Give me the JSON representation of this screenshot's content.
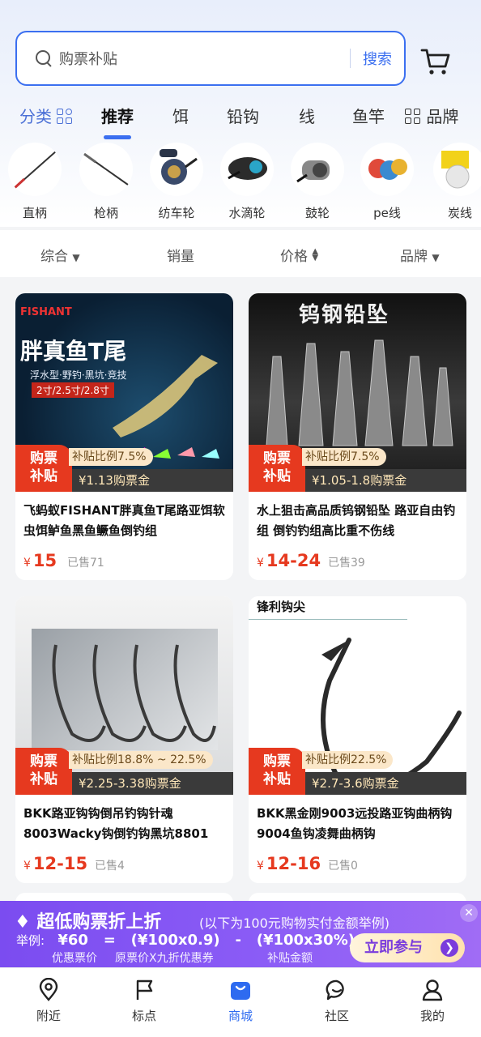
{
  "search": {
    "placeholder": "购票补贴",
    "button": "搜索"
  },
  "tabs": [
    {
      "label": "分类"
    },
    {
      "label": "推荐"
    },
    {
      "label": "饵"
    },
    {
      "label": "铅钩"
    },
    {
      "label": "线"
    },
    {
      "label": "鱼竿"
    },
    {
      "label": "品牌"
    }
  ],
  "categories": [
    {
      "label": "直柄"
    },
    {
      "label": "枪柄"
    },
    {
      "label": "纺车轮"
    },
    {
      "label": "水滴轮"
    },
    {
      "label": "鼓轮"
    },
    {
      "label": "pe线"
    },
    {
      "label": "炭线"
    }
  ],
  "sort": {
    "overall": "综合",
    "sales": "销量",
    "price": "价格",
    "brand": "品牌"
  },
  "badge_label_1": "购票",
  "badge_label_2": "补贴",
  "products": [
    {
      "image_text_brand": "FISHANT",
      "image_text_title": "胖真鱼T尾",
      "image_text_sub": "浮水型·野钓·黑坑·竞技",
      "image_text_sizes": "2寸/2.5寸/2.8寸",
      "ratio": "补贴比例7.5%",
      "gold": "¥1.13购票金",
      "title": "飞蚂蚁FISHANT胖真鱼T尾路亚饵软虫饵鲈鱼黑鱼鳜鱼倒钓组",
      "currency": "¥",
      "price": "15",
      "sold": "已售71"
    },
    {
      "image_text_title": "钨钢铅坠",
      "ratio": "补贴比例7.5%",
      "gold": "¥1.05-1.8购票金",
      "title": "水上狙击高品质钨钢铅坠 路亚自由钓组 倒钓钓组高比重不伤线",
      "currency": "¥",
      "price": "14-24",
      "sold": "已售39"
    },
    {
      "ratio": "补贴比例18.8% ~ 22.5%",
      "gold": "¥2.25-3.38购票金",
      "title": "BKK路亚钩钩倒吊钓钩针魂8003Wacky钩倒钓钩黑坑8801",
      "currency": "¥",
      "price": "12-15",
      "sold": "已售4"
    },
    {
      "image_text_title": "锋利钩尖",
      "ratio": "补贴比例22.5%",
      "gold": "¥2.7-3.6购票金",
      "title": "BKK黑金刚9003远投路亚钩曲柄钩9004鱼钩凌舞曲柄钩",
      "currency": "¥",
      "price": "12-16",
      "sold": "已售0"
    }
  ],
  "promo": {
    "headline": "超低购票折上折",
    "sub": "(以下为100元购物实付金额举例)",
    "example_label": "举例:",
    "formula": "¥60   =   (¥100x0.9)   -   (¥100x30%)",
    "caption_1": "优惠票价",
    "caption_2": "原票价X九折优惠券",
    "caption_3": "补贴金额",
    "button": "立即参与",
    "close": "✕"
  },
  "nav": [
    {
      "label": "附近",
      "icon": "location-icon"
    },
    {
      "label": "标点",
      "icon": "flag-icon"
    },
    {
      "label": "商城",
      "icon": "shopping-bag-icon"
    },
    {
      "label": "社区",
      "icon": "chat-icon"
    },
    {
      "label": "我的",
      "icon": "profile-icon"
    }
  ],
  "colors": {
    "accent": "#3b6ff0",
    "price": "#e6391f",
    "promo": "#8b5cf6"
  }
}
